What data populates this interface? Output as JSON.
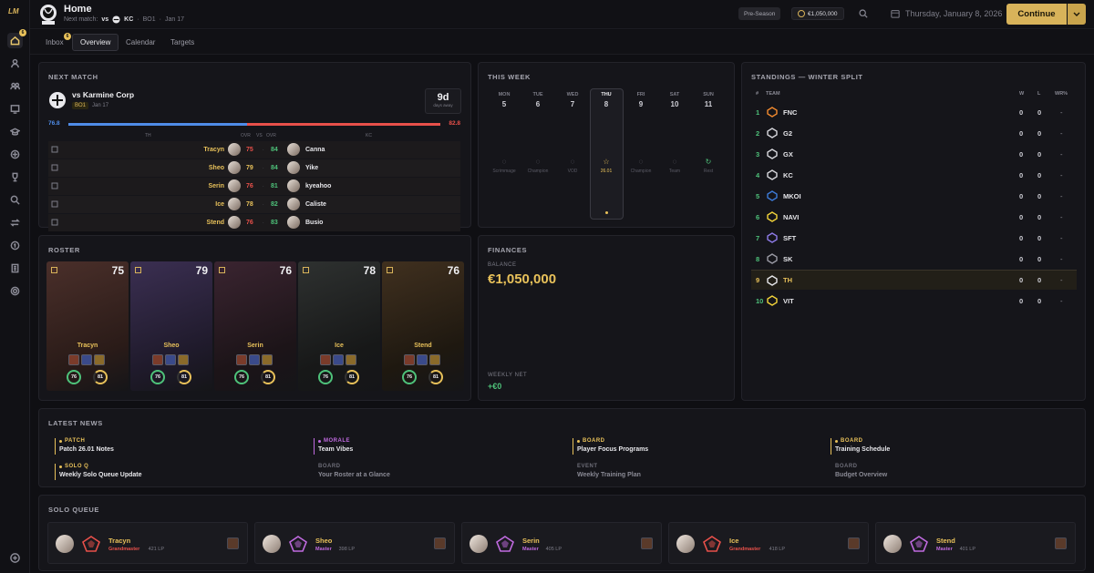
{
  "app": {
    "logo_text": "LM"
  },
  "sidebar": {
    "badge": "6",
    "items": [
      {
        "icon": "home-icon",
        "active": true
      },
      {
        "icon": "user-icon"
      },
      {
        "icon": "team-icon"
      },
      {
        "icon": "news-icon"
      },
      {
        "icon": "academy-icon"
      },
      {
        "icon": "champion-icon"
      },
      {
        "icon": "trophy-icon"
      },
      {
        "icon": "search-icon"
      },
      {
        "icon": "transfer-icon"
      },
      {
        "icon": "finance-icon"
      },
      {
        "icon": "building-icon"
      },
      {
        "icon": "settings-icon"
      }
    ],
    "bottom_icon": "add-icon"
  },
  "header": {
    "title": "Home",
    "next_match_label": "Next match:",
    "next_vs": "vs",
    "next_team": "KC",
    "next_format": "BO1",
    "next_date": "Jan 17",
    "season_phase": "Pre-Season",
    "money": "€1,050,000",
    "date": "Thursday, January 8, 2026",
    "continue_label": "Continue"
  },
  "tabs": {
    "inbox": "Inbox",
    "inbox_badge": "6",
    "overview": "Overview",
    "calendar": "Calendar",
    "targets": "Targets"
  },
  "next_match": {
    "title": "NEXT MATCH",
    "opponent": "vs Karmine Corp",
    "format": "BO1",
    "date": "Jan 17",
    "days": "9d",
    "days_label": "days away",
    "rating_left": "76.8",
    "rating_right": "82.8",
    "left_tag": "TH",
    "right_tag": "KC",
    "ovr_label": "OVR",
    "vs_label": "VS",
    "matchups": [
      {
        "home": "Tracyn",
        "home_ovr": "75",
        "away_ovr": "84",
        "away": "Canna"
      },
      {
        "home": "Sheo",
        "home_ovr": "79",
        "away_ovr": "84",
        "away": "Yike"
      },
      {
        "home": "Serin",
        "home_ovr": "76",
        "away_ovr": "81",
        "away": "kyeahoo"
      },
      {
        "home": "Ice",
        "home_ovr": "78",
        "away_ovr": "82",
        "away": "Caliste"
      },
      {
        "home": "Stend",
        "home_ovr": "76",
        "away_ovr": "83",
        "away": "Busio"
      }
    ]
  },
  "this_week": {
    "title": "THIS WEEK",
    "days": [
      {
        "name": "MON",
        "num": "5",
        "activity": "Scrimmage",
        "icon": "scrim-icon"
      },
      {
        "name": "TUE",
        "num": "6",
        "activity": "Champion",
        "icon": "champion-icon"
      },
      {
        "name": "WED",
        "num": "7",
        "activity": "VOD",
        "icon": "vod-icon"
      },
      {
        "name": "THU",
        "num": "8",
        "activity": "26.01",
        "icon": "star-icon",
        "today": true
      },
      {
        "name": "FRI",
        "num": "9",
        "activity": "Champion",
        "icon": "champion-icon"
      },
      {
        "name": "SAT",
        "num": "10",
        "activity": "Team",
        "icon": "team-icon"
      },
      {
        "name": "SUN",
        "num": "11",
        "activity": "Rest",
        "icon": "rest-icon"
      }
    ]
  },
  "standings": {
    "title": "STANDINGS — WINTER SPLIT",
    "headers": {
      "rank": "#",
      "team": "TEAM",
      "w": "W",
      "l": "L",
      "wr": "WR%"
    },
    "rows": [
      {
        "rank": "1",
        "team": "FNC",
        "w": "0",
        "l": "0",
        "wr": "-"
      },
      {
        "rank": "2",
        "team": "G2",
        "w": "0",
        "l": "0",
        "wr": "-"
      },
      {
        "rank": "3",
        "team": "GX",
        "w": "0",
        "l": "0",
        "wr": "-"
      },
      {
        "rank": "4",
        "team": "KC",
        "w": "0",
        "l": "0",
        "wr": "-"
      },
      {
        "rank": "5",
        "team": "MKOI",
        "w": "0",
        "l": "0",
        "wr": "-"
      },
      {
        "rank": "6",
        "team": "NAVI",
        "w": "0",
        "l": "0",
        "wr": "-"
      },
      {
        "rank": "7",
        "team": "SFT",
        "w": "0",
        "l": "0",
        "wr": "-"
      },
      {
        "rank": "8",
        "team": "SK",
        "w": "0",
        "l": "0",
        "wr": "-"
      },
      {
        "rank": "9",
        "team": "TH",
        "w": "0",
        "l": "0",
        "wr": "-",
        "highlight": true
      },
      {
        "rank": "10",
        "team": "VIT",
        "w": "0",
        "l": "0",
        "wr": "-"
      }
    ]
  },
  "roster": {
    "title": "ROSTER",
    "players": [
      {
        "name": "Tracyn",
        "ovr": "75",
        "ring1": "76",
        "ring2": "81",
        "colors": [
          "#4a2f2a",
          "#2a1b18"
        ]
      },
      {
        "name": "Sheo",
        "ovr": "79",
        "ring1": "76",
        "ring2": "81",
        "colors": [
          "#3b2f52",
          "#1f1a2b"
        ]
      },
      {
        "name": "Serin",
        "ovr": "76",
        "ring1": "76",
        "ring2": "81",
        "colors": [
          "#3a2430",
          "#1c1418"
        ]
      },
      {
        "name": "Ice",
        "ovr": "78",
        "ring1": "76",
        "ring2": "81",
        "colors": [
          "#2e3130",
          "#171818"
        ]
      },
      {
        "name": "Stend",
        "ovr": "76",
        "ring1": "76",
        "ring2": "81",
        "colors": [
          "#40301f",
          "#1e1810"
        ]
      }
    ]
  },
  "finances": {
    "title": "FINANCES",
    "balance_label": "BALANCE",
    "balance": "€1,050,000",
    "weekly_label": "WEEKLY NET",
    "weekly_value": "+€0"
  },
  "news": {
    "title": "LATEST NEWS",
    "items": [
      {
        "category": "PATCH",
        "title": "Patch 26.01 Notes",
        "color": "#e8c15a",
        "dim": false
      },
      {
        "category": "MORALE",
        "title": "Team Vibes",
        "color": "#c06ae0",
        "dim": false
      },
      {
        "category": "BOARD",
        "title": "Player Focus Programs",
        "color": "#e8c15a",
        "dim": false
      },
      {
        "category": "BOARD",
        "title": "Training Schedule",
        "color": "#e8c15a",
        "dim": false
      },
      {
        "category": "SOLO Q",
        "title": "Weekly Solo Queue Update",
        "color": "#e8c15a",
        "dim": false
      },
      {
        "category": "BOARD",
        "title": "Your Roster at a Glance",
        "color": "#e8c15a",
        "dim": true
      },
      {
        "category": "EVENT",
        "title": "Weekly Training Plan",
        "color": "#e8c15a",
        "dim": true
      },
      {
        "category": "BOARD",
        "title": "Budget Overview",
        "color": "#e8c15a",
        "dim": true
      }
    ]
  },
  "solo_queue": {
    "title": "SOLO QUEUE",
    "players": [
      {
        "name": "Tracyn",
        "tier": "Grandmaster",
        "lp": "421 LP",
        "tier_color": "#e8504a"
      },
      {
        "name": "Sheo",
        "tier": "Master",
        "lp": "398 LP",
        "tier_color": "#c06ae0"
      },
      {
        "name": "Serin",
        "tier": "Master",
        "lp": "405 LP",
        "tier_color": "#c06ae0"
      },
      {
        "name": "Ice",
        "tier": "Grandmaster",
        "lp": "418 LP",
        "tier_color": "#e8504a"
      },
      {
        "name": "Stend",
        "tier": "Master",
        "lp": "401 LP",
        "tier_color": "#c06ae0"
      }
    ]
  }
}
